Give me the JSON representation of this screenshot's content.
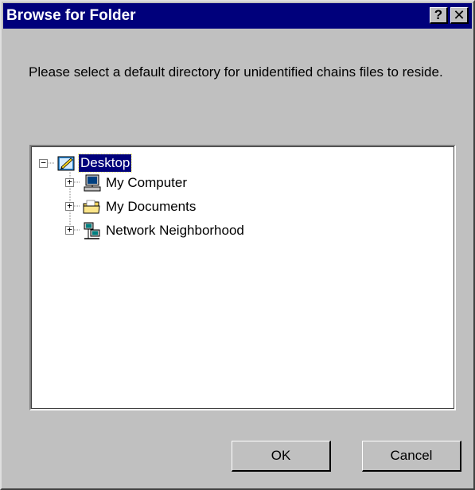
{
  "window": {
    "title": "Browse for Folder",
    "help_label": "?",
    "close_label": "✕"
  },
  "prompt": "Please select a default directory for unidentified chains files to reside.",
  "tree": {
    "root": {
      "label": "Desktop",
      "expander": "−",
      "icon": "desktop-icon",
      "selected": true
    },
    "children": [
      {
        "label": "My Computer",
        "expander": "+",
        "icon": "computer-icon"
      },
      {
        "label": "My Documents",
        "expander": "+",
        "icon": "folder-icon"
      },
      {
        "label": "Network Neighborhood",
        "expander": "+",
        "icon": "network-icon"
      }
    ]
  },
  "buttons": {
    "ok": "OK",
    "cancel": "Cancel"
  },
  "colors": {
    "titlebar": "#00007b",
    "face": "#c0c0c0",
    "selection": "#00007b"
  }
}
